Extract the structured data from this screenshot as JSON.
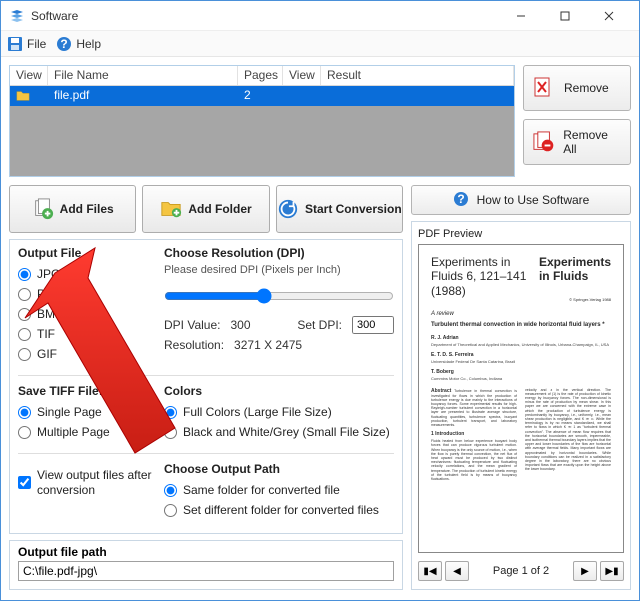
{
  "window": {
    "title": "Software",
    "menu": {
      "file": "File",
      "help": "Help"
    }
  },
  "table": {
    "headers": {
      "view": "View",
      "filename": "File Name",
      "pages": "Pages",
      "view2": "View",
      "result": "Result"
    },
    "rows": [
      {
        "filename": "file.pdf",
        "pages": "2",
        "result": ""
      }
    ]
  },
  "buttons": {
    "remove": "Remove",
    "remove_all": "Remove All",
    "add_files": "Add Files",
    "add_folder": "Add Folder",
    "start_conversion": "Start Conversion",
    "how_to_use": "How to Use Software"
  },
  "output_file": {
    "heading": "Output File",
    "options": [
      "JPG",
      "PNG",
      "BMP",
      "TIF",
      "GIF"
    ],
    "selected": "JPG"
  },
  "dpi": {
    "heading": "Choose Resolution (DPI)",
    "desc": "Please desired DPI (Pixels per Inch)",
    "value_label": "DPI Value:",
    "value": "300",
    "set_label": "Set DPI:",
    "set_value": "300",
    "res_label": "Resolution:",
    "res_value": "3271 X 2475"
  },
  "save_tiff": {
    "heading": "Save TIFF File:",
    "options": [
      "Single Page",
      "Multiple Page"
    ],
    "selected": "Single Page"
  },
  "colors": {
    "heading": "Colors",
    "options": [
      "Full Colors (Large File Size)",
      "Black and White/Grey (Small File Size)"
    ],
    "selected": "Full Colors (Large File Size)"
  },
  "view_output": {
    "label": "View output files after conversion",
    "checked": true
  },
  "output_path": {
    "choose_heading": "Choose Output Path",
    "same": "Same folder for converted file",
    "diff": "Set different folder for converted files",
    "selected": "same",
    "path_heading": "Output file path",
    "path": "C:\\file.pdf-jpg\\"
  },
  "preview": {
    "heading": "PDF Preview",
    "page_indicator": "Page 1 of 2",
    "doc": {
      "journal_left": "Experiments in Fluids 6, 121–141 (1988)",
      "journal_right": "Experiments in Fluids",
      "publisher": "© Springer-Verlag 1988",
      "review": "A review",
      "title": "Turbulent thermal convection in wide horizontal fluid layers *",
      "author1": "R. J. Adrian",
      "aff1": "Department of Theoretical and Applied Mechanics, University of Illinois, Urbana-Champaign, IL, USA",
      "author2": "E. T. D. S. Ferreira",
      "aff2": "Universidade Federal De Santa Catarina, Brazil",
      "author3": "T. Boberg",
      "aff3": "Cummins Motor Co., Columbus, Indiana",
      "sec1": "Abstract",
      "sec2": "1 Introduction"
    }
  }
}
